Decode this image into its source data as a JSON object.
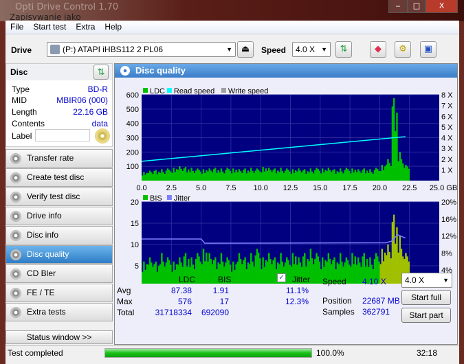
{
  "window": {
    "title": "Opti Drive Control 1.70",
    "overlay_title": "Zapisywanie jako",
    "min": "‒",
    "max": "□",
    "close": "X"
  },
  "menu": [
    "File",
    "Start test",
    "Extra",
    "Help"
  ],
  "toolbar": {
    "drive_label": "Drive",
    "drive_value": "(P:)   ATAPI iHBS112   2 PL06",
    "speed_label": "Speed",
    "speed_value": "4.0 X"
  },
  "disc": {
    "header": "Disc",
    "rows": [
      {
        "k": "Type",
        "v": "BD-R"
      },
      {
        "k": "MID",
        "v": "MBIR06 (000)"
      },
      {
        "k": "Length",
        "v": "22.16 GB"
      },
      {
        "k": "Contents",
        "v": "data"
      }
    ],
    "label_key": "Label",
    "label_value": ""
  },
  "nav": [
    "Transfer rate",
    "Create test disc",
    "Verify test disc",
    "Drive info",
    "Disc info",
    "Disc quality",
    "CD Bler",
    "FE / TE",
    "Extra tests"
  ],
  "nav_selected": 5,
  "status_window": "Status window >>",
  "panel": {
    "title": "Disc quality"
  },
  "stats": {
    "col_ldc": "LDC",
    "col_bis": "BIS",
    "jitter_label": "Jitter",
    "jitter_checked": true,
    "avg_label": "Avg",
    "max_label": "Max",
    "total_label": "Total",
    "avg_ldc": "87.38",
    "avg_bis": "1.91",
    "avg_jitter": "11.1%",
    "max_ldc": "576",
    "max_bis": "17",
    "max_jitter": "12.3%",
    "total_ldc": "31718334",
    "total_bis": "692090",
    "speed_label": "Speed",
    "speed_value": "4.10 X",
    "position_label": "Position",
    "position_value": "22687 MB",
    "samples_label": "Samples",
    "samples_value": "362791",
    "speed_select": "4.0 X",
    "start_full": "Start full",
    "start_part": "Start part"
  },
  "statusbar": {
    "text": "Test completed",
    "progress": 100,
    "percent": "100.0%",
    "time": "32:18"
  },
  "chart_data": [
    {
      "type": "bar",
      "legend": [
        "LDC",
        "Read speed",
        "Write speed"
      ],
      "colors": {
        "LDC": "#00c000",
        "Read speed": "#00ffff",
        "Write speed": "#a0a0a0"
      },
      "xlim": [
        0,
        25
      ],
      "xticks": [
        "0.0",
        "2.5",
        "5.0",
        "7.5",
        "10.0",
        "12.5",
        "15.0",
        "17.5",
        "20.0",
        "22.5",
        "25.0 GB"
      ],
      "ylim": [
        0,
        600
      ],
      "yticks": [
        "100",
        "200",
        "300",
        "400",
        "500",
        "600"
      ],
      "y2lim": [
        0,
        8
      ],
      "y2ticks": [
        "1 X",
        "2 X",
        "3 X",
        "4 X",
        "5 X",
        "6 X",
        "7 X",
        "8 X"
      ],
      "x_step": 0.5,
      "ldc": [
        60,
        70,
        75,
        80,
        85,
        90,
        100,
        95,
        90,
        85,
        80,
        85,
        90,
        85,
        90,
        85,
        80,
        85,
        90,
        85,
        95,
        90,
        85,
        90,
        85,
        80,
        85,
        80,
        85,
        90,
        85,
        90,
        80,
        85,
        90,
        85,
        80,
        85,
        80,
        90,
        110,
        150,
        576,
        200,
        110
      ],
      "read_speed": {
        "x": [
          0,
          22.16
        ],
        "y": [
          1.8,
          4.1
        ]
      }
    },
    {
      "type": "bar",
      "legend": [
        "BIS",
        "Jitter"
      ],
      "colors": {
        "BIS": "#00c000",
        "Jitter": "#8080ff"
      },
      "xlim": [
        0,
        25
      ],
      "xticks": [
        "0.0",
        "2.5",
        "5.0",
        "7.5",
        "10.0",
        "12.5",
        "15.0",
        "17.5",
        "20.0",
        "22.5",
        "25.0 GB"
      ],
      "ylim": [
        0,
        20
      ],
      "yticks": [
        "5",
        "10",
        "15",
        "20"
      ],
      "y2ticks": [
        "4%",
        "8%",
        "12%",
        "16%",
        "20%"
      ],
      "x_step": 0.5,
      "bis": [
        6,
        7,
        6,
        8,
        7,
        6,
        7,
        8,
        7,
        8,
        9,
        8,
        7,
        8,
        7,
        6,
        8,
        7,
        8,
        9,
        7,
        8,
        7,
        8,
        7,
        8,
        7,
        8,
        9,
        8,
        7,
        8,
        7,
        8,
        7,
        8,
        7,
        8,
        7,
        8,
        9,
        10,
        17,
        12,
        8
      ],
      "jitter": {
        "x": [
          0,
          5,
          5.3,
          20.5,
          21,
          21.5,
          22.16
        ],
        "y": [
          11.3,
          11.3,
          10.3,
          10.4,
          10.8,
          12.3,
          11.5
        ]
      }
    }
  ]
}
